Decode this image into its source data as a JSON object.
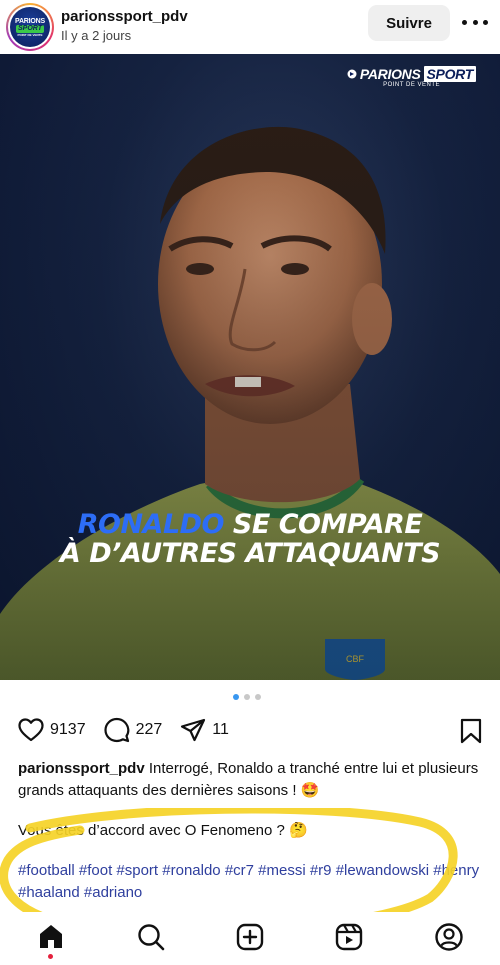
{
  "header": {
    "username": "parionssport_pdv",
    "time_ago": "Il y a 2 jours",
    "follow_label": "Suivre",
    "avatar_text": {
      "line1": "PARIONS",
      "line2": "SPORT",
      "line3": "POINT DE VENTE"
    }
  },
  "post": {
    "brand_logo": {
      "name": "PARIONS",
      "box": "SPORT",
      "sub": "POINT DE VENTE"
    },
    "headline": {
      "line1_highlight": "RONALDO",
      "line1_rest": " SE COMPARE",
      "line2": "À D’AUTRES ATTAQUANTS"
    },
    "carousel": {
      "current": 1,
      "total": 3
    }
  },
  "actions": {
    "likes": "9137",
    "comments": "227",
    "shares": "11"
  },
  "caption": {
    "username": "parionssport_pdv",
    "text": " Interrogé, Ronaldo a tranché entre lui et plusieurs grands attaquants des dernières saisons ! 🤩",
    "question": "Vous êtes d’accord avec O Fenomeno ? 🤔",
    "hashtags": "#football #foot #sport #ronaldo #cr7 #messi #r9 #lewandowski #henry #haaland #adriano"
  },
  "colors": {
    "accent_blue": "#2d6df6",
    "hashtag": "#2f3f9e",
    "highlight_marker": "#f5d327",
    "notification_dot": "#e4213d"
  },
  "nav": {
    "items": [
      "home-icon",
      "search-icon",
      "create-icon",
      "reels-icon",
      "profile-icon"
    ]
  }
}
